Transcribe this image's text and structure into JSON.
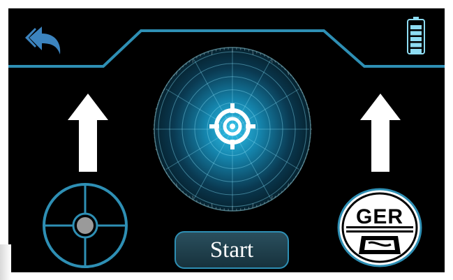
{
  "start_button": {
    "label": "Start"
  },
  "logo": {
    "text": "GER"
  },
  "icons": {
    "back": "back-arrow-icon",
    "battery": "battery-icon",
    "move_up_left": "up-arrow-icon",
    "move_up_right": "up-arrow-icon",
    "target": "crosshair-target-icon",
    "joystick": "joystick-icon",
    "logo": "ger-logo"
  },
  "battery": {
    "level": 1.0,
    "bars": 5
  },
  "colors": {
    "accent": "#2e8fb4",
    "background": "#000000",
    "radar_glow": "#2fb7e0",
    "button_fill": "#234654"
  }
}
